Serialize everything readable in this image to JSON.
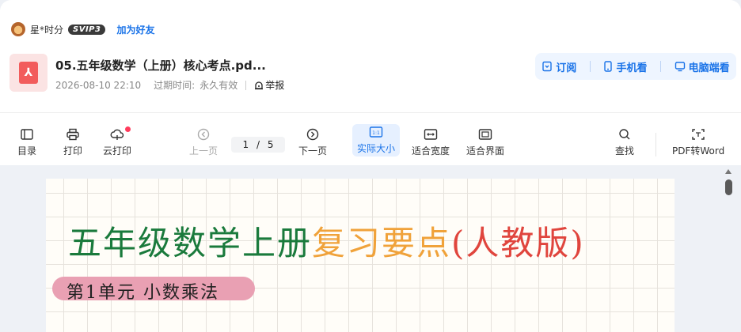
{
  "user": {
    "name": "星*时分",
    "level": "SVIP3",
    "add_friend": "加为好友"
  },
  "file": {
    "title": "05.五年级数学（上册）核心考点.pd...",
    "date": "2026-08-10 22:10",
    "expire_label": "过期时间:",
    "expire_value": "永久有效",
    "report": "举报"
  },
  "actions": {
    "subscribe": "订阅",
    "mobile": "手机看",
    "desktop": "电脑端看"
  },
  "toolbar": {
    "toc": "目录",
    "print": "打印",
    "cloud_print": "云打印",
    "prev": "上一页",
    "page_current": "1",
    "page_total": "5",
    "page_sep": "/",
    "next": "下一页",
    "actual_size": "实际大小",
    "fit_width": "适合宽度",
    "fit_page": "适合界面",
    "find": "查找",
    "pdf_to_word": "PDF转Word"
  },
  "document": {
    "title_part1": "五年级数学上册",
    "title_part2": "复习要点",
    "title_part3": "(人教版)",
    "unit": "第1单元  小数乘法"
  },
  "colors": {
    "accent": "#1a73e8",
    "title_green": "#1a7a3c",
    "title_orange": "#f0a23a",
    "title_red": "#e0453d",
    "tag_pink": "#e9a0b3"
  },
  "icons": [
    "avatar",
    "pdf-file-icon",
    "bookmark-icon",
    "phone-icon",
    "monitor-icon",
    "toc-icon",
    "printer-icon",
    "cloud-print-icon",
    "arrow-left-icon",
    "arrow-right-icon",
    "actual-size-icon",
    "fit-width-icon",
    "fit-page-icon",
    "search-icon",
    "pdf-word-icon"
  ]
}
